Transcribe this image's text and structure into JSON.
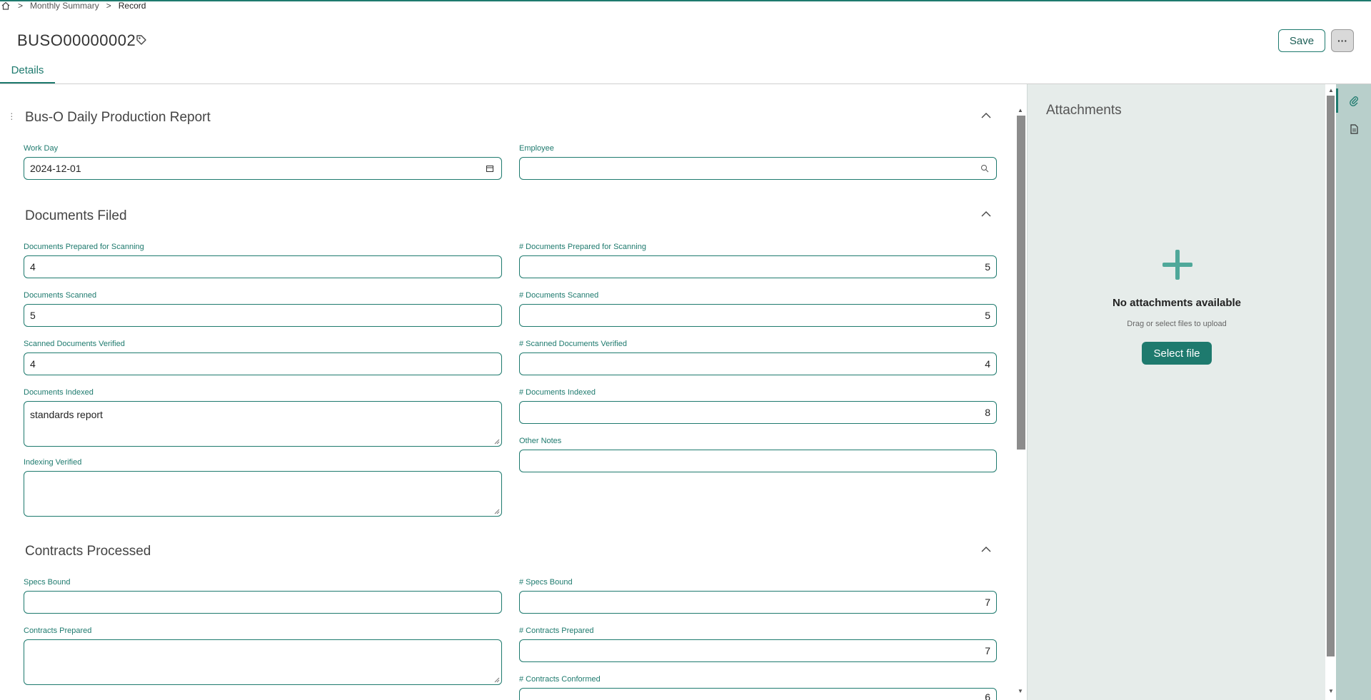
{
  "breadcrumb": {
    "items": [
      "Monthly Summary",
      "Record"
    ]
  },
  "header": {
    "title": "BUSO00000002",
    "save_label": "Save",
    "more_label": "···"
  },
  "tabs": [
    {
      "label": "Details",
      "active": true
    }
  ],
  "sections": {
    "daily": {
      "title": "Bus-O Daily Production Report",
      "work_day_label": "Work Day",
      "work_day_value": "2024-12-01",
      "employee_label": "Employee",
      "employee_value": ""
    },
    "documents": {
      "title": "Documents Filed",
      "prepared_label": "Documents Prepared for Scanning",
      "prepared_value": "4",
      "num_prepared_label": "# Documents Prepared for Scanning",
      "num_prepared_value": "5",
      "scanned_label": "Documents Scanned",
      "scanned_value": "5",
      "num_scanned_label": "# Documents Scanned",
      "num_scanned_value": "5",
      "verified_label": "Scanned Documents Verified",
      "verified_value": "4",
      "num_verified_label": "# Scanned Documents Verified",
      "num_verified_value": "4",
      "indexed_label": "Documents Indexed",
      "indexed_value": "standards report",
      "num_indexed_label": "# Documents Indexed",
      "num_indexed_value": "8",
      "indexing_verified_label": "Indexing Verified",
      "indexing_verified_value": "",
      "other_notes_label": "Other Notes",
      "other_notes_value": ""
    },
    "contracts": {
      "title": "Contracts Processed",
      "specs_label": "Specs Bound",
      "specs_value": "",
      "num_specs_label": "# Specs Bound",
      "num_specs_value": "7",
      "prepared_label": "Contracts Prepared",
      "prepared_value": "",
      "num_prepared_label": "# Contracts Prepared",
      "num_prepared_value": "7",
      "num_conformed_label": "# Contracts Conformed",
      "num_conformed_value": "6"
    }
  },
  "attachments": {
    "title": "Attachments",
    "empty_title": "No attachments available",
    "empty_hint": "Drag or select files to upload",
    "select_label": "Select file"
  },
  "colors": {
    "accent": "#1e7a6e",
    "panel_bg": "#e6ecea",
    "rail_bg": "#b8cfcb"
  },
  "icons": {
    "home": "home-icon",
    "tag": "tag-icon",
    "calendar": "calendar-icon",
    "search": "search-icon",
    "paperclip": "paperclip-icon",
    "document": "document-icon"
  }
}
